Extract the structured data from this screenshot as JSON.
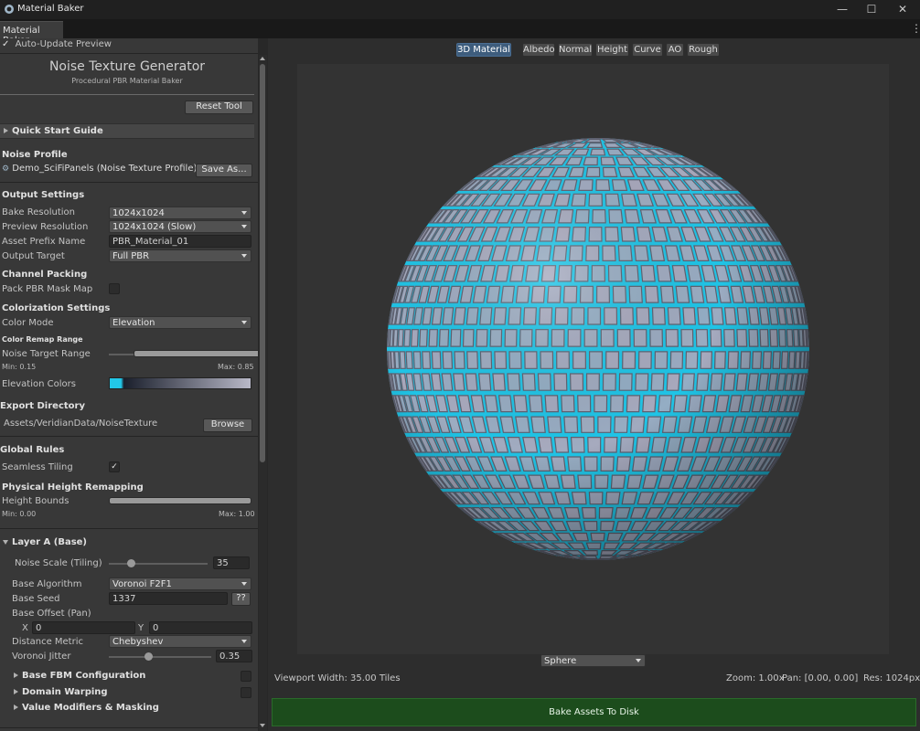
{
  "window": {
    "title": "Material Baker",
    "tab": "Material Baker"
  },
  "top": {
    "auto_update_label": "Auto-Update Preview",
    "auto_update_checked": true
  },
  "header": {
    "title": "Noise Texture Generator",
    "subtitle": "Procedural PBR Material Baker",
    "reset_button": "Reset Tool"
  },
  "quick_start": {
    "label": "Quick Start Guide"
  },
  "noise_profile": {
    "label": "Noise Profile",
    "value": "Demo_SciFiPanels (Noise Texture Profile)",
    "save_button": "Save As..."
  },
  "output_settings": {
    "label": "Output Settings",
    "bake_resolution_label": "Bake Resolution",
    "bake_resolution": "1024x1024",
    "preview_resolution_label": "Preview Resolution",
    "preview_resolution": "1024x1024 (Slow)",
    "asset_prefix_label": "Asset Prefix Name",
    "asset_prefix": "PBR_Material_01",
    "output_target_label": "Output Target",
    "output_target": "Full PBR"
  },
  "channel_packing": {
    "label": "Channel Packing",
    "pack_mask_label": "Pack PBR Mask Map",
    "pack_mask_checked": false
  },
  "colorization": {
    "label": "Colorization Settings",
    "color_mode_label": "Color Mode",
    "color_mode": "Elevation",
    "remap_label": "Color Remap Range",
    "noise_target_label": "Noise Target Range",
    "min_label": "Min: 0.15",
    "max_label": "Max: 0.85",
    "min_value": 0.15,
    "max_value": 0.85,
    "elevation_colors_label": "Elevation Colors",
    "gradient_colors": [
      "#22c7e8",
      "#1a1f2c",
      "#b9b9c8"
    ]
  },
  "export": {
    "label": "Export Directory",
    "path": "Assets/VeridianData/NoiseTexture",
    "browse_button": "Browse"
  },
  "global_rules": {
    "label": "Global Rules",
    "seamless_label": "Seamless Tiling",
    "seamless_checked": true
  },
  "physical_height": {
    "label": "Physical Height Remapping",
    "bounds_label": "Height Bounds",
    "min_label": "Min: 0.00",
    "max_label": "Max: 1.00",
    "min_value": 0.0,
    "max_value": 1.0
  },
  "layer_a": {
    "label": "Layer A (Base)",
    "noise_scale_label": "Noise Scale (Tiling)",
    "noise_scale": "35",
    "noise_scale_fraction": 0.13,
    "algorithm_label": "Base Algorithm",
    "algorithm": "Voronoi F2F1",
    "seed_label": "Base Seed",
    "seed": "1337",
    "seed_button": "??",
    "offset_label": "Base Offset (Pan)",
    "x_label": "X",
    "x_value": "0",
    "y_label": "Y",
    "y_value": "0",
    "metric_label": "Distance Metric",
    "metric": "Chebyshev",
    "jitter_label": "Voronoi Jitter",
    "jitter": "0.35",
    "jitter_fraction": 0.35,
    "fbm_label": "Base FBM Configuration",
    "warping_label": "Domain Warping",
    "modifiers_label": "Value Modifiers & Masking"
  },
  "viewport": {
    "tabs": [
      "3D Material",
      "Albedo",
      "Normal",
      "Height",
      "Curve",
      "AO",
      "Rough"
    ],
    "active_tab": "3D Material",
    "shape": "Sphere",
    "width_text": "Viewport Width: 35.00 Tiles",
    "zoom_text": "Zoom: 1.00x",
    "pan_text": "Pan: [0.00, 0.00]",
    "res_text": "Res: 1024px",
    "bake_button": "Bake Assets To Disk",
    "colors": {
      "tile": "#a9a9bd",
      "grout": "#20c4e6",
      "background": "#333333"
    }
  }
}
